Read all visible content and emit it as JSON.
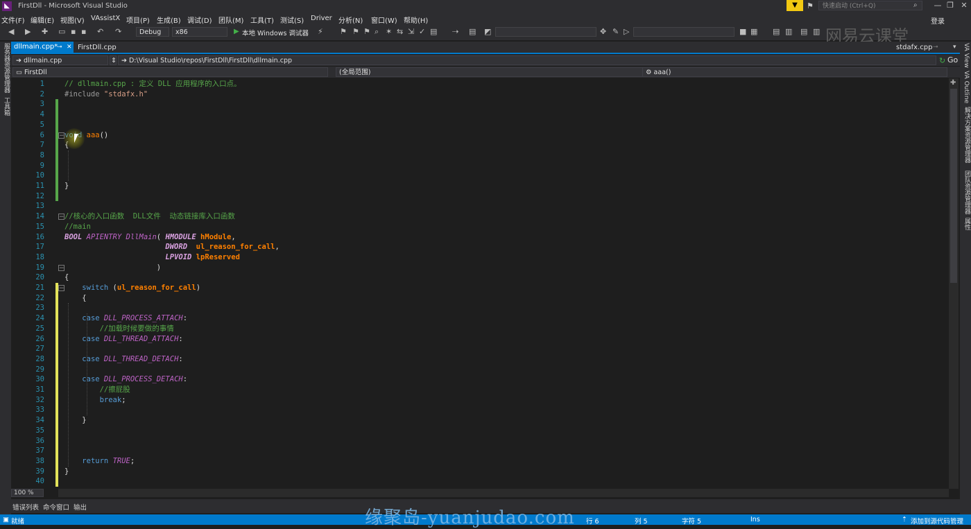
{
  "window": {
    "title": "FirstDll - Microsoft Visual Studio",
    "quick_launch_placeholder": "快速启动 (Ctrl+Q)",
    "login": "登录"
  },
  "menu": [
    "文件(F)",
    "编辑(E)",
    "视图(V)",
    "VAssistX",
    "项目(P)",
    "生成(B)",
    "调试(D)",
    "团队(M)",
    "工具(T)",
    "测试(S)",
    "Driver",
    "分析(N)",
    "窗口(W)",
    "帮助(H)"
  ],
  "toolbar": {
    "configuration": "Debug",
    "platform": "x86",
    "debug_target": "本地 Windows 调试器"
  },
  "watermark_logo": "网易云课堂",
  "tabs": {
    "active": "dllmain.cpp*",
    "second": "FirstDll.cpp",
    "right": "stdafx.cpp"
  },
  "nav": {
    "file": "dllmain.cpp",
    "path": "D:\\Visual Studio\\repos\\FirstDll\\FirstDll\\dllmain.cpp",
    "go": "Go",
    "project": "FirstDll",
    "scope": "(全局范围)",
    "member": "aaa()"
  },
  "left_panel": [
    "服务器资源管理器",
    "工具箱"
  ],
  "right_panel": [
    "VA View",
    "VA Outline",
    "解决方案资源管理器",
    "团队资源管理器",
    "属性"
  ],
  "zoom": "100 %",
  "bottom_tabs": [
    "错误列表",
    "命令窗口",
    "输出"
  ],
  "status": {
    "ready": "就绪",
    "line": "行 6",
    "col": "列 5",
    "char": "字符 5",
    "mode": "Ins",
    "source_control": "添加到源代码管理"
  },
  "site_watermark": "缘聚岛-yuanjudao.com",
  "code_lines": [
    {
      "n": "1",
      "indent": 0,
      "tokens": [
        [
          "comment",
          "// dllmain.cpp : 定义 DLL 应用程序的入口点。"
        ]
      ]
    },
    {
      "n": "2",
      "indent": 0,
      "tokens": [
        [
          "pp",
          "#include "
        ],
        [
          "str",
          "\"stdafx.h\""
        ]
      ]
    },
    {
      "n": "3",
      "indent": 0,
      "tokens": []
    },
    {
      "n": "4",
      "indent": 0,
      "tokens": []
    },
    {
      "n": "5",
      "indent": 0,
      "tokens": []
    },
    {
      "n": "6",
      "indent": 0,
      "tokens": [
        [
          "kw",
          "void"
        ],
        [
          "plain",
          " "
        ],
        [
          "fn",
          "aaa"
        ],
        [
          "plain",
          "()"
        ]
      ]
    },
    {
      "n": "7",
      "indent": 0,
      "tokens": [
        [
          "plain",
          "{"
        ]
      ]
    },
    {
      "n": "8",
      "indent": 0,
      "tokens": []
    },
    {
      "n": "9",
      "indent": 0,
      "tokens": []
    },
    {
      "n": "10",
      "indent": 0,
      "tokens": []
    },
    {
      "n": "11",
      "indent": 0,
      "tokens": [
        [
          "plain",
          "}"
        ]
      ]
    },
    {
      "n": "12",
      "indent": 0,
      "tokens": []
    },
    {
      "n": "13",
      "indent": 0,
      "tokens": []
    },
    {
      "n": "14",
      "indent": 0,
      "tokens": [
        [
          "comment",
          "//核心的入口函数  DLL文件  动态链接库入口函数"
        ]
      ]
    },
    {
      "n": "15",
      "indent": 0,
      "tokens": [
        [
          "comment",
          "//main"
        ]
      ]
    },
    {
      "n": "16",
      "indent": 0,
      "tokens": [
        [
          "type",
          "BOOL"
        ],
        [
          "plain",
          " "
        ],
        [
          "macro",
          "APIENTRY"
        ],
        [
          "plain",
          " "
        ],
        [
          "fnit",
          "DllMain"
        ],
        [
          "plain",
          "( "
        ],
        [
          "type",
          "HMODULE"
        ],
        [
          "plain",
          " "
        ],
        [
          "param",
          "hModule"
        ],
        [
          "plain",
          ","
        ]
      ]
    },
    {
      "n": "17",
      "indent": 0,
      "tokens": [
        [
          "plain",
          "                       "
        ],
        [
          "type",
          "DWORD"
        ],
        [
          "plain",
          "  "
        ],
        [
          "param",
          "ul_reason_for_call"
        ],
        [
          "plain",
          ","
        ]
      ]
    },
    {
      "n": "18",
      "indent": 0,
      "tokens": [
        [
          "plain",
          "                       "
        ],
        [
          "type",
          "LPVOID"
        ],
        [
          "plain",
          " "
        ],
        [
          "param",
          "lpReserved"
        ]
      ]
    },
    {
      "n": "19",
      "indent": 0,
      "tokens": [
        [
          "plain",
          "                     )"
        ]
      ]
    },
    {
      "n": "20",
      "indent": 0,
      "tokens": [
        [
          "plain",
          "{"
        ]
      ]
    },
    {
      "n": "21",
      "indent": 0,
      "tokens": [
        [
          "plain",
          "    "
        ],
        [
          "kw",
          "switch"
        ],
        [
          "plain",
          " ("
        ],
        [
          "param",
          "ul_reason_for_call"
        ],
        [
          "plain",
          ")"
        ]
      ]
    },
    {
      "n": "22",
      "indent": 0,
      "tokens": [
        [
          "plain",
          "    {"
        ]
      ]
    },
    {
      "n": "23",
      "indent": 0,
      "tokens": []
    },
    {
      "n": "24",
      "indent": 0,
      "tokens": [
        [
          "plain",
          "    "
        ],
        [
          "kw",
          "case"
        ],
        [
          "plain",
          " "
        ],
        [
          "macro",
          "DLL_PROCESS_ATTACH"
        ],
        [
          "plain",
          ":"
        ]
      ]
    },
    {
      "n": "25",
      "indent": 0,
      "tokens": [
        [
          "plain",
          "        "
        ],
        [
          "comment",
          "//加载时候要做的事情"
        ]
      ]
    },
    {
      "n": "26",
      "indent": 0,
      "tokens": [
        [
          "plain",
          "    "
        ],
        [
          "kw",
          "case"
        ],
        [
          "plain",
          " "
        ],
        [
          "macro",
          "DLL_THREAD_ATTACH"
        ],
        [
          "plain",
          ":"
        ]
      ]
    },
    {
      "n": "27",
      "indent": 0,
      "tokens": []
    },
    {
      "n": "28",
      "indent": 0,
      "tokens": [
        [
          "plain",
          "    "
        ],
        [
          "kw",
          "case"
        ],
        [
          "plain",
          " "
        ],
        [
          "macro",
          "DLL_THREAD_DETACH"
        ],
        [
          "plain",
          ":"
        ]
      ]
    },
    {
      "n": "29",
      "indent": 0,
      "tokens": []
    },
    {
      "n": "30",
      "indent": 0,
      "tokens": [
        [
          "plain",
          "    "
        ],
        [
          "kw",
          "case"
        ],
        [
          "plain",
          " "
        ],
        [
          "macro",
          "DLL_PROCESS_DETACH"
        ],
        [
          "plain",
          ":"
        ]
      ]
    },
    {
      "n": "31",
      "indent": 0,
      "tokens": [
        [
          "plain",
          "        "
        ],
        [
          "comment",
          "//擦屁股"
        ]
      ]
    },
    {
      "n": "32",
      "indent": 0,
      "tokens": [
        [
          "plain",
          "        "
        ],
        [
          "kw",
          "break"
        ],
        [
          "plain",
          ";"
        ]
      ]
    },
    {
      "n": "33",
      "indent": 0,
      "tokens": []
    },
    {
      "n": "34",
      "indent": 0,
      "tokens": [
        [
          "plain",
          "    }"
        ]
      ]
    },
    {
      "n": "35",
      "indent": 0,
      "tokens": []
    },
    {
      "n": "36",
      "indent": 0,
      "tokens": []
    },
    {
      "n": "37",
      "indent": 0,
      "tokens": []
    },
    {
      "n": "38",
      "indent": 0,
      "tokens": [
        [
          "plain",
          "    "
        ],
        [
          "kw",
          "return"
        ],
        [
          "plain",
          " "
        ],
        [
          "macro",
          "TRUE"
        ],
        [
          "plain",
          ";"
        ]
      ]
    },
    {
      "n": "39",
      "indent": 0,
      "tokens": [
        [
          "plain",
          "}"
        ]
      ]
    },
    {
      "n": "40",
      "indent": 0,
      "tokens": []
    }
  ],
  "colors": {
    "accent": "#007acc",
    "change_saved": "#57a64a",
    "change_unsaved": "#e3e35a",
    "keyword": "#569cd6",
    "comment": "#57a64a"
  }
}
